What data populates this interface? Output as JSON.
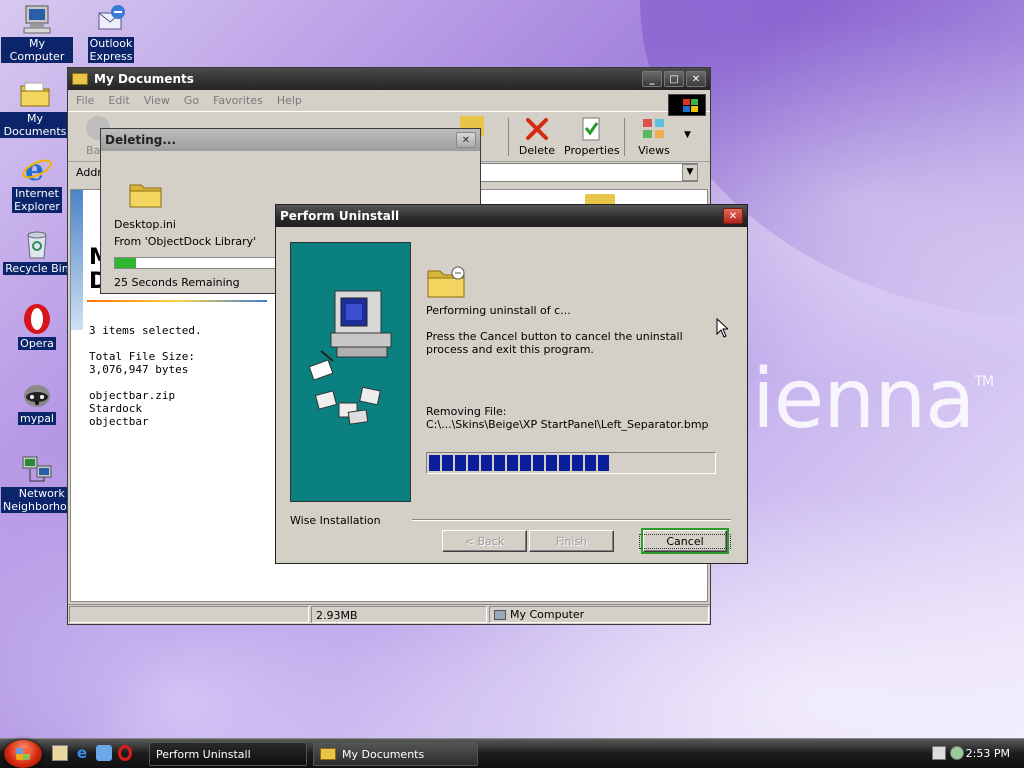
{
  "desktop": {
    "wallpaper_text": "ienna",
    "wallpaper_tm": "TM",
    "icons": [
      {
        "label_lines": [
          "My Computer"
        ],
        "icon": "my-computer-icon"
      },
      {
        "label_lines": [
          "Outlook",
          "Express"
        ],
        "icon": "outlook-express-icon"
      },
      {
        "label_lines": [
          "My Documents"
        ],
        "icon": "my-documents-icon"
      },
      {
        "label_lines": [
          "Internet",
          "Explorer"
        ],
        "icon": "internet-explorer-icon"
      },
      {
        "label_lines": [
          "Recycle Bin"
        ],
        "icon": "recycle-bin-icon"
      },
      {
        "label_lines": [
          "Opera"
        ],
        "icon": "opera-icon"
      },
      {
        "label_lines": [
          "mypal"
        ],
        "icon": "mypal-icon"
      },
      {
        "label_lines": [
          "Network",
          "Neighborhood"
        ],
        "icon": "network-neighborhood-icon"
      }
    ]
  },
  "explorer": {
    "title": "My Documents",
    "menu": [
      "File",
      "Edit",
      "View",
      "Go",
      "Favorites",
      "Help"
    ],
    "toolbar": {
      "back": "Back",
      "up": "Up",
      "delete": "Delete",
      "properties": "Properties",
      "views": "Views"
    },
    "address_label": "Address",
    "left_pane": {
      "heading_partial": [
        "M",
        "D"
      ],
      "selected": "3 items selected.",
      "size_label": "Total File Size:",
      "size_value": "3,076,947 bytes",
      "files": [
        "objectbar.zip",
        "Stardock",
        "objectbar"
      ]
    },
    "status": {
      "size": "2.93MB",
      "zone": "My Computer"
    }
  },
  "deleting": {
    "title": "Deleting...",
    "file": "Desktop.ini",
    "from": "From 'ObjectDock Library'",
    "progress": 0.08,
    "remaining": "25 Seconds Remaining"
  },
  "uninstall": {
    "title": "Perform Uninstall",
    "heading": "Performing uninstall of c...",
    "instructions": "Press the Cancel button to cancel the uninstall process and exit this program.",
    "removing_label": "Removing File:",
    "removing_path": "C:\\...\\Skins\\Beige\\XP StartPanel\\Left_Separator.bmp",
    "progress_blocks_filled": 14,
    "progress_blocks_total": 22,
    "brand": "Wise Installation",
    "buttons": {
      "back": "< Back",
      "finish": "Finish",
      "cancel": "Cancel"
    }
  },
  "taskbar": {
    "tasks": [
      "Perform Uninstall",
      "My Documents"
    ],
    "clock": "2:53 PM"
  }
}
